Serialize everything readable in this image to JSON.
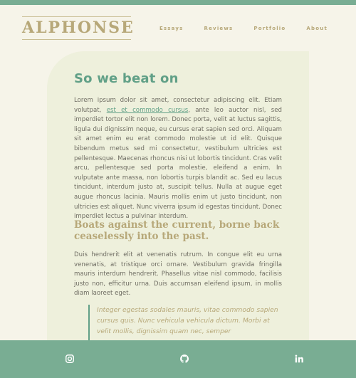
{
  "brand": {
    "logo_text": "ALPHONSE"
  },
  "nav": {
    "items": [
      "Essays",
      "Reviews",
      "Portfolio",
      "About"
    ]
  },
  "article": {
    "title": "So we beat on",
    "p1_before": "Lorem ipsum dolor sit amet, consectetur adipiscing elit. Etiam volutpat, ",
    "p1_link": "est et commodo cursus",
    "p1_after": ", ante leo auctor nisl, sed imperdiet tortor elit non lorem. Donec porta, velit at luctus sagittis, ligula dui dignissim neque, eu cursus erat sapien sed orci. Aliquam sit amet enim eu erat commodo molestie ut id elit. Quisque bibendum metus sed mi consectetur, vestibulum ultricies est pellentesque. Maecenas rhoncus nisi ut lobortis tincidunt. Cras velit arcu, pellentesque sed porta molestie, eleifend a enim. In vulputate ante massa, non lobortis turpis blandit ac. Sed eu lacus tincidunt, interdum justo at, suscipit tellus. Nulla at augue eget augue rhoncus lacinia. Mauris mollis enim ut justo tincidunt, non ultricies est aliquet. Nunc viverra ipsum id egestas tincidunt. Donec imperdiet lectus a pulvinar interdum.",
    "subtitle": "Boats against the current, borne back ceaselessly into the past.",
    "p2": "Duis hendrerit elit at venenatis rutrum. In congue elit eu urna venenatis, at tristique orci ornare. Vestibulum gravida fringilla mauris interdum hendrerit. Phasellus vitae nisl commodo, facilisis justo non, efficitur urna. Duis accumsan eleifend ipsum, in mollis diam laoreet eget.",
    "quote": "Integer egestas sodales mauris, vitae commodo sapien cursus quis. Nunc vehicula vehicula dictum. Morbi at velit mollis, dignissim quam nec, semper"
  },
  "footer": {
    "social_icons": [
      "instagram-icon",
      "github-icon",
      "linkedin-icon"
    ]
  },
  "colors": {
    "accent_green": "#61a087",
    "bar_green": "#79ad93",
    "gold": "#b7a879",
    "page_bg": "#f6f4e9",
    "card_bg": "#eef0dc"
  }
}
